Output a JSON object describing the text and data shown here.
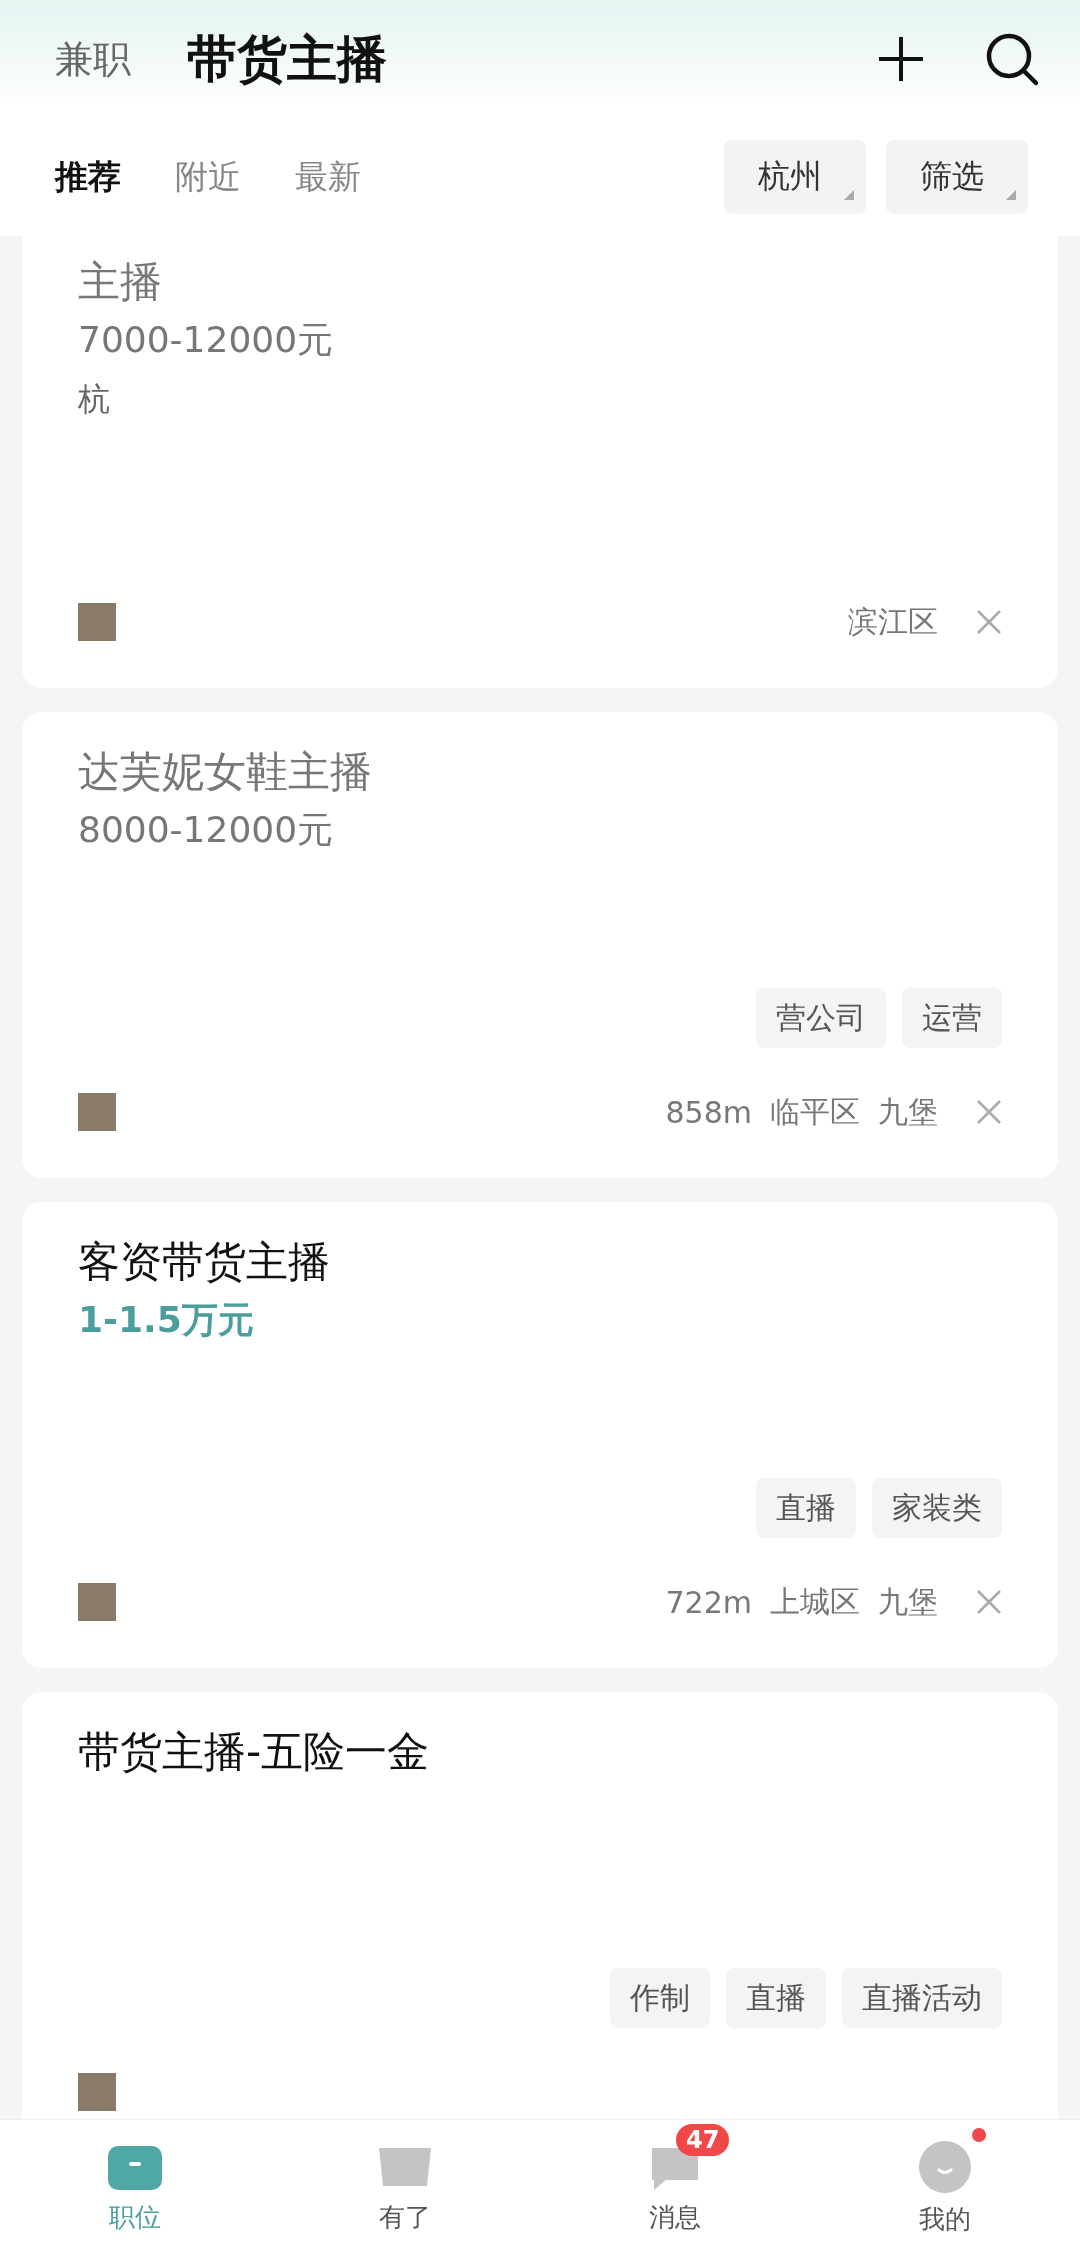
{
  "header": {
    "category": "兼职",
    "title": "带货主播"
  },
  "tabs": [
    {
      "label": "推荐",
      "selected": true
    },
    {
      "label": "附近",
      "selected": false
    },
    {
      "label": "最新",
      "selected": false
    }
  ],
  "filters": [
    "杭州",
    "筛选"
  ],
  "jobs": [
    {
      "title": "主播",
      "salary": "7000-12000元",
      "viewed": true,
      "location": "杭",
      "district": "滨江区"
    },
    {
      "title": "达芙妮女鞋主播",
      "salary": "8000-12000元",
      "viewed": true,
      "tags": [
        "营公司",
        "运营"
      ],
      "distance": "858m",
      "district": "临平区",
      "area": "九堡"
    },
    {
      "title": "客资带货主播",
      "salary": "1-1.5万元",
      "viewed": false,
      "tags": [
        "直播",
        "家装类"
      ],
      "distance": "722m",
      "district": "上城区",
      "area": "九堡"
    },
    {
      "title": "带货主播-五险一金",
      "viewed": false,
      "tags": [
        "作制",
        "直播",
        "直播活动"
      ]
    }
  ],
  "nav": [
    {
      "label": "职位",
      "selected": true
    },
    {
      "label": "有了",
      "selected": false
    },
    {
      "label": "消息",
      "selected": false,
      "badge": "47"
    },
    {
      "label": "我的",
      "selected": false,
      "dot": true
    }
  ]
}
